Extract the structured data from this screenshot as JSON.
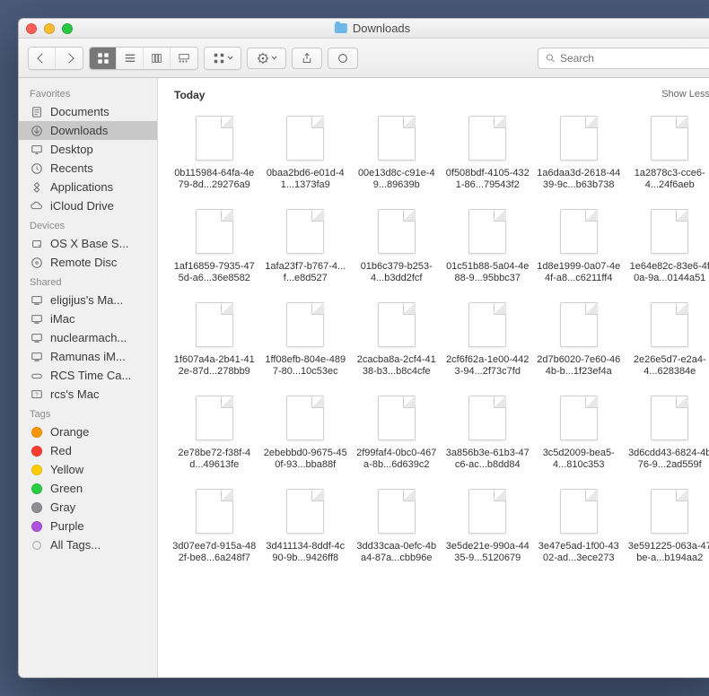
{
  "window": {
    "title": "Downloads"
  },
  "toolbar": {
    "search_placeholder": "Search"
  },
  "sidebar": {
    "sections": [
      {
        "header": "Favorites",
        "items": [
          {
            "label": "Documents",
            "icon": "doc",
            "selected": false
          },
          {
            "label": "Downloads",
            "icon": "download",
            "selected": true
          },
          {
            "label": "Desktop",
            "icon": "desktop",
            "selected": false
          },
          {
            "label": "Recents",
            "icon": "clock",
            "selected": false
          },
          {
            "label": "Applications",
            "icon": "apps",
            "selected": false
          },
          {
            "label": "iCloud Drive",
            "icon": "cloud",
            "selected": false
          }
        ]
      },
      {
        "header": "Devices",
        "items": [
          {
            "label": "OS X Base S...",
            "icon": "disk",
            "selected": false
          },
          {
            "label": "Remote Disc",
            "icon": "disc",
            "selected": false
          }
        ]
      },
      {
        "header": "Shared",
        "items": [
          {
            "label": "eligijus's Ma...",
            "icon": "computer",
            "selected": false
          },
          {
            "label": "iMac",
            "icon": "computer",
            "selected": false
          },
          {
            "label": "nuclearmach...",
            "icon": "computer",
            "selected": false
          },
          {
            "label": "Ramunas iM...",
            "icon": "computer",
            "selected": false
          },
          {
            "label": "RCS Time Ca...",
            "icon": "timecapsule",
            "selected": false
          },
          {
            "label": "rcs's Mac",
            "icon": "computer-q",
            "selected": false
          }
        ]
      },
      {
        "header": "Tags",
        "items": [
          {
            "label": "Orange",
            "icon": "tag",
            "color": "#ff9500"
          },
          {
            "label": "Red",
            "icon": "tag",
            "color": "#ff3b30"
          },
          {
            "label": "Yellow",
            "icon": "tag",
            "color": "#ffcc00"
          },
          {
            "label": "Green",
            "icon": "tag",
            "color": "#28cd41"
          },
          {
            "label": "Gray",
            "icon": "tag",
            "color": "#8e8e93"
          },
          {
            "label": "Purple",
            "icon": "tag",
            "color": "#af52de"
          },
          {
            "label": "All Tags...",
            "icon": "alltags",
            "color": "#c0c0c0"
          }
        ]
      }
    ]
  },
  "content": {
    "section_label": "Today",
    "show_less_label": "Show Less",
    "files": [
      {
        "name": "0b115984-64fa-4e79-8d...29276a9"
      },
      {
        "name": "0baa2bd6-e01d-41...1373fa9"
      },
      {
        "name": "00e13d8c-c91e-49...89639b"
      },
      {
        "name": "0f508bdf-4105-4321-86...79543f2"
      },
      {
        "name": "1a6daa3d-2618-4439-9c...b63b738"
      },
      {
        "name": "1a2878c3-cce6-4...24f6aeb"
      },
      {
        "name": "1af16859-7935-475d-a6...36e8582"
      },
      {
        "name": "1afa23f7-b767-4...f...e8d527"
      },
      {
        "name": "01b6c379-b253-4...b3dd2fcf"
      },
      {
        "name": "01c51b88-5a04-4e88-9...95bbc37"
      },
      {
        "name": "1d8e1999-0a07-4e4f-a8...c6211ff4"
      },
      {
        "name": "1e64e82c-83e6-4f0a-9a...0144a51"
      },
      {
        "name": "1f607a4a-2b41-412e-87d...278bb9"
      },
      {
        "name": "1ff08efb-804e-4897-80...10c53ec"
      },
      {
        "name": "2cacba8a-2cf4-4138-b3...b8c4cfe"
      },
      {
        "name": "2cf6f62a-1e00-4423-94...2f73c7fd"
      },
      {
        "name": "2d7b6020-7e60-464b-b...1f23ef4a"
      },
      {
        "name": "2e26e5d7-e2a4-4...628384e"
      },
      {
        "name": "2e78be72-f38f-4d...49613fe"
      },
      {
        "name": "2ebebbd0-9675-450f-93...bba88f"
      },
      {
        "name": "2f99faf4-0bc0-467a-8b...6d639c2"
      },
      {
        "name": "3a856b3e-61b3-47c6-ac...b8dd84"
      },
      {
        "name": "3c5d2009-bea5-4...810c353"
      },
      {
        "name": "3d6cdd43-6824-4b76-9...2ad559f"
      },
      {
        "name": "3d07ee7d-915a-482f-be8...6a248f7"
      },
      {
        "name": "3d411134-8ddf-4c90-9b...9426ff8"
      },
      {
        "name": "3dd33caa-0efc-4ba4-87a...cbb96e"
      },
      {
        "name": "3e5de21e-990a-4435-9...5120679"
      },
      {
        "name": "3e47e5ad-1f00-4302-ad...3ece273"
      },
      {
        "name": "3e591225-063a-47be-a...b194aa2"
      }
    ]
  }
}
